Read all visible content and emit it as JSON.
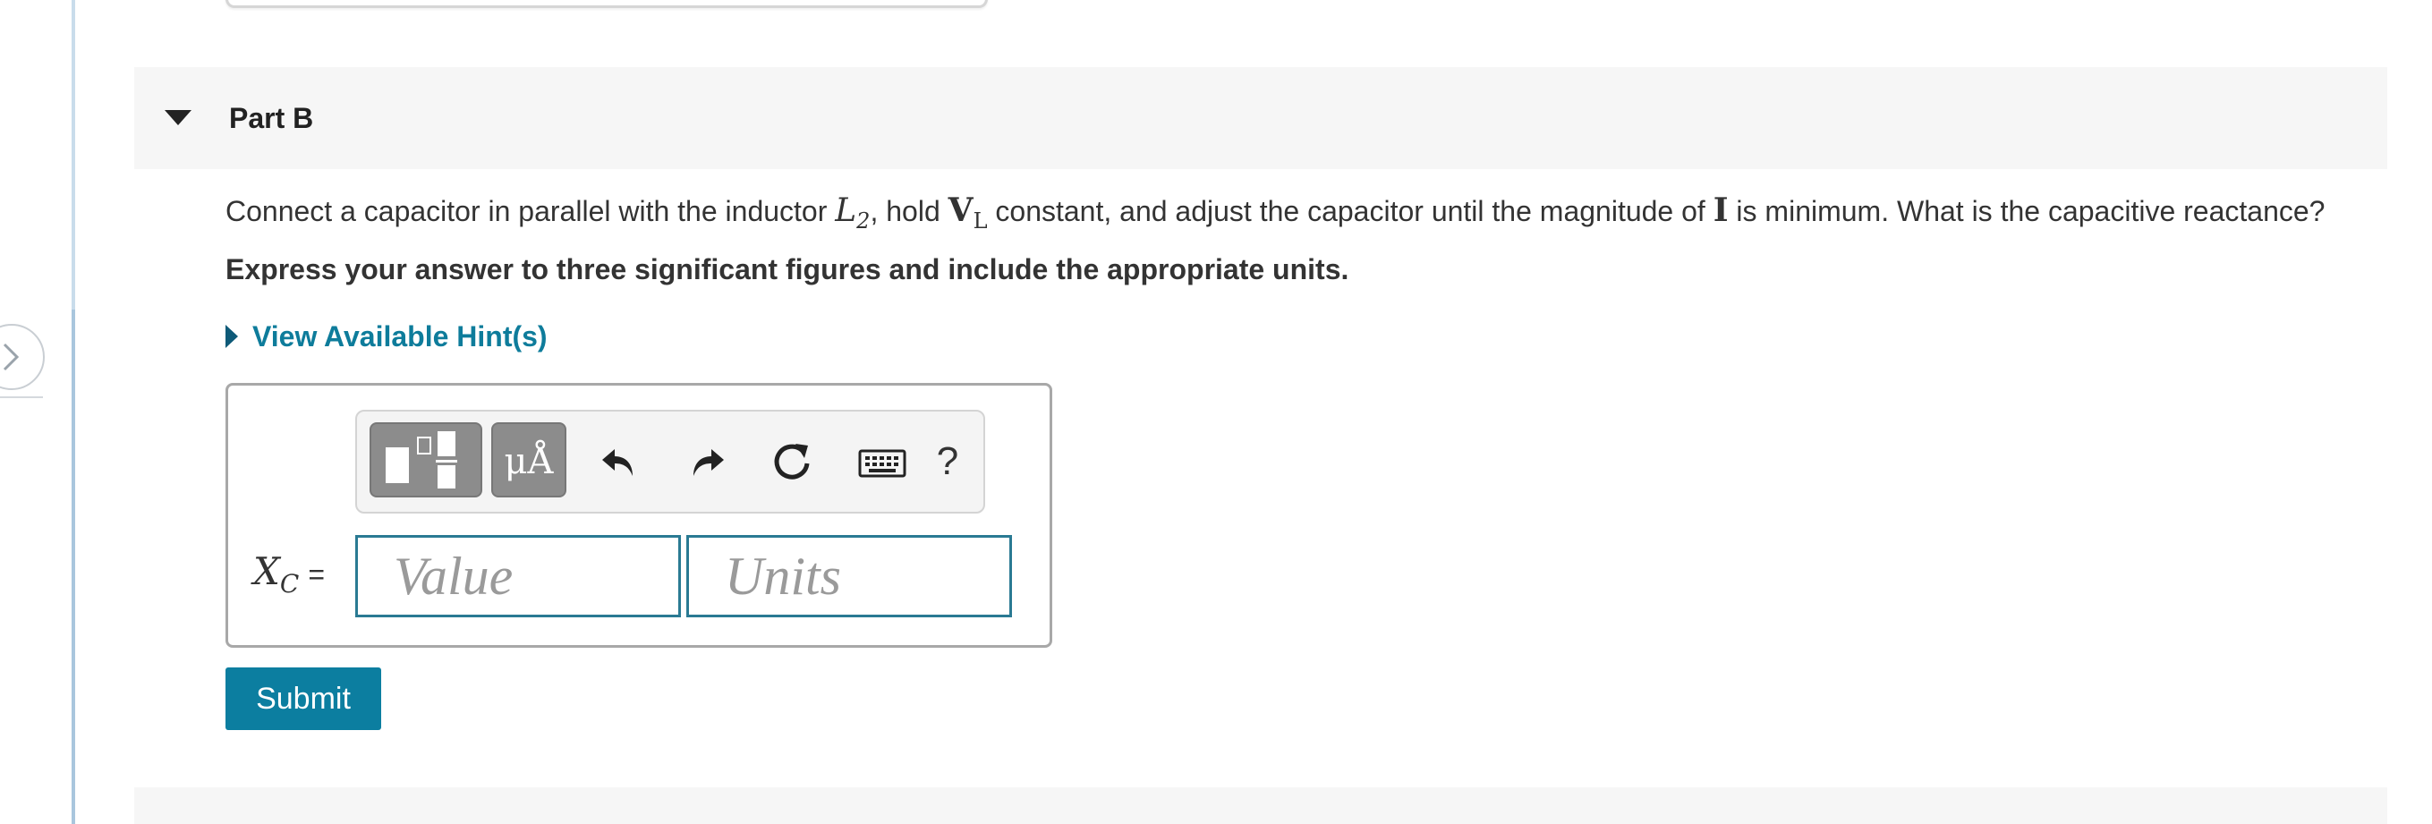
{
  "part": {
    "title": "Part B"
  },
  "question": {
    "text_1": "Connect a capacitor in parallel with the inductor ",
    "sym_L": "L",
    "sym_L_sub": "2",
    "text_2": ", hold ",
    "sym_V": "V",
    "sym_V_sub": "L",
    "text_3": " constant, and adjust the capacitor until the magnitude of ",
    "sym_I": "I",
    "text_4": " is  minimum. What is the capacitive reactance?"
  },
  "instruction": "Express your answer to three significant figures and include the appropriate units.",
  "hints": {
    "label": "View Available Hint(s)"
  },
  "toolbar": {
    "units_label": "μÅ",
    "help_label": "?"
  },
  "answer": {
    "var_symbol": "X",
    "var_sub": "C",
    "equals": "=",
    "value_placeholder": "Value",
    "units_placeholder": "Units",
    "value": "",
    "units": ""
  },
  "submit_label": "Submit",
  "icons": {
    "collapse": "caret-down-icon",
    "expand_panel": "chevron-right-icon",
    "hint_caret": "caret-right-icon",
    "templates": "templates-icon",
    "undo": "undo-icon",
    "redo": "redo-icon",
    "reset": "reset-icon",
    "keyboard": "keyboard-icon"
  },
  "colors": {
    "accent": "#0c7ea0",
    "link": "#0e7c9b",
    "header_bg": "#f6f6f6"
  }
}
